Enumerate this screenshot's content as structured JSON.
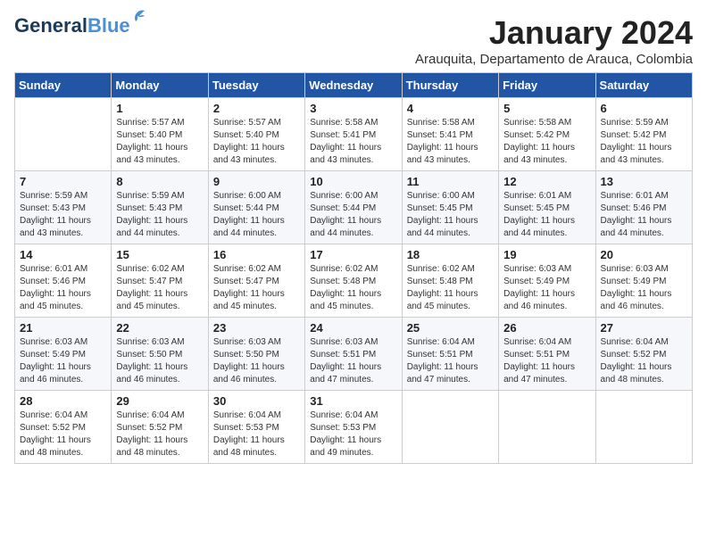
{
  "header": {
    "logo_general": "General",
    "logo_blue": "Blue",
    "month_title": "January 2024",
    "subtitle": "Arauquita, Departamento de Arauca, Colombia"
  },
  "weekdays": [
    "Sunday",
    "Monday",
    "Tuesday",
    "Wednesday",
    "Thursday",
    "Friday",
    "Saturday"
  ],
  "weeks": [
    [
      {
        "day": "",
        "info": ""
      },
      {
        "day": "1",
        "info": "Sunrise: 5:57 AM\nSunset: 5:40 PM\nDaylight: 11 hours\nand 43 minutes."
      },
      {
        "day": "2",
        "info": "Sunrise: 5:57 AM\nSunset: 5:40 PM\nDaylight: 11 hours\nand 43 minutes."
      },
      {
        "day": "3",
        "info": "Sunrise: 5:58 AM\nSunset: 5:41 PM\nDaylight: 11 hours\nand 43 minutes."
      },
      {
        "day": "4",
        "info": "Sunrise: 5:58 AM\nSunset: 5:41 PM\nDaylight: 11 hours\nand 43 minutes."
      },
      {
        "day": "5",
        "info": "Sunrise: 5:58 AM\nSunset: 5:42 PM\nDaylight: 11 hours\nand 43 minutes."
      },
      {
        "day": "6",
        "info": "Sunrise: 5:59 AM\nSunset: 5:42 PM\nDaylight: 11 hours\nand 43 minutes."
      }
    ],
    [
      {
        "day": "7",
        "info": "Sunrise: 5:59 AM\nSunset: 5:43 PM\nDaylight: 11 hours\nand 43 minutes."
      },
      {
        "day": "8",
        "info": "Sunrise: 5:59 AM\nSunset: 5:43 PM\nDaylight: 11 hours\nand 44 minutes."
      },
      {
        "day": "9",
        "info": "Sunrise: 6:00 AM\nSunset: 5:44 PM\nDaylight: 11 hours\nand 44 minutes."
      },
      {
        "day": "10",
        "info": "Sunrise: 6:00 AM\nSunset: 5:44 PM\nDaylight: 11 hours\nand 44 minutes."
      },
      {
        "day": "11",
        "info": "Sunrise: 6:00 AM\nSunset: 5:45 PM\nDaylight: 11 hours\nand 44 minutes."
      },
      {
        "day": "12",
        "info": "Sunrise: 6:01 AM\nSunset: 5:45 PM\nDaylight: 11 hours\nand 44 minutes."
      },
      {
        "day": "13",
        "info": "Sunrise: 6:01 AM\nSunset: 5:46 PM\nDaylight: 11 hours\nand 44 minutes."
      }
    ],
    [
      {
        "day": "14",
        "info": "Sunrise: 6:01 AM\nSunset: 5:46 PM\nDaylight: 11 hours\nand 45 minutes."
      },
      {
        "day": "15",
        "info": "Sunrise: 6:02 AM\nSunset: 5:47 PM\nDaylight: 11 hours\nand 45 minutes."
      },
      {
        "day": "16",
        "info": "Sunrise: 6:02 AM\nSunset: 5:47 PM\nDaylight: 11 hours\nand 45 minutes."
      },
      {
        "day": "17",
        "info": "Sunrise: 6:02 AM\nSunset: 5:48 PM\nDaylight: 11 hours\nand 45 minutes."
      },
      {
        "day": "18",
        "info": "Sunrise: 6:02 AM\nSunset: 5:48 PM\nDaylight: 11 hours\nand 45 minutes."
      },
      {
        "day": "19",
        "info": "Sunrise: 6:03 AM\nSunset: 5:49 PM\nDaylight: 11 hours\nand 46 minutes."
      },
      {
        "day": "20",
        "info": "Sunrise: 6:03 AM\nSunset: 5:49 PM\nDaylight: 11 hours\nand 46 minutes."
      }
    ],
    [
      {
        "day": "21",
        "info": "Sunrise: 6:03 AM\nSunset: 5:49 PM\nDaylight: 11 hours\nand 46 minutes."
      },
      {
        "day": "22",
        "info": "Sunrise: 6:03 AM\nSunset: 5:50 PM\nDaylight: 11 hours\nand 46 minutes."
      },
      {
        "day": "23",
        "info": "Sunrise: 6:03 AM\nSunset: 5:50 PM\nDaylight: 11 hours\nand 46 minutes."
      },
      {
        "day": "24",
        "info": "Sunrise: 6:03 AM\nSunset: 5:51 PM\nDaylight: 11 hours\nand 47 minutes."
      },
      {
        "day": "25",
        "info": "Sunrise: 6:04 AM\nSunset: 5:51 PM\nDaylight: 11 hours\nand 47 minutes."
      },
      {
        "day": "26",
        "info": "Sunrise: 6:04 AM\nSunset: 5:51 PM\nDaylight: 11 hours\nand 47 minutes."
      },
      {
        "day": "27",
        "info": "Sunrise: 6:04 AM\nSunset: 5:52 PM\nDaylight: 11 hours\nand 48 minutes."
      }
    ],
    [
      {
        "day": "28",
        "info": "Sunrise: 6:04 AM\nSunset: 5:52 PM\nDaylight: 11 hours\nand 48 minutes."
      },
      {
        "day": "29",
        "info": "Sunrise: 6:04 AM\nSunset: 5:52 PM\nDaylight: 11 hours\nand 48 minutes."
      },
      {
        "day": "30",
        "info": "Sunrise: 6:04 AM\nSunset: 5:53 PM\nDaylight: 11 hours\nand 48 minutes."
      },
      {
        "day": "31",
        "info": "Sunrise: 6:04 AM\nSunset: 5:53 PM\nDaylight: 11 hours\nand 49 minutes."
      },
      {
        "day": "",
        "info": ""
      },
      {
        "day": "",
        "info": ""
      },
      {
        "day": "",
        "info": ""
      }
    ]
  ]
}
